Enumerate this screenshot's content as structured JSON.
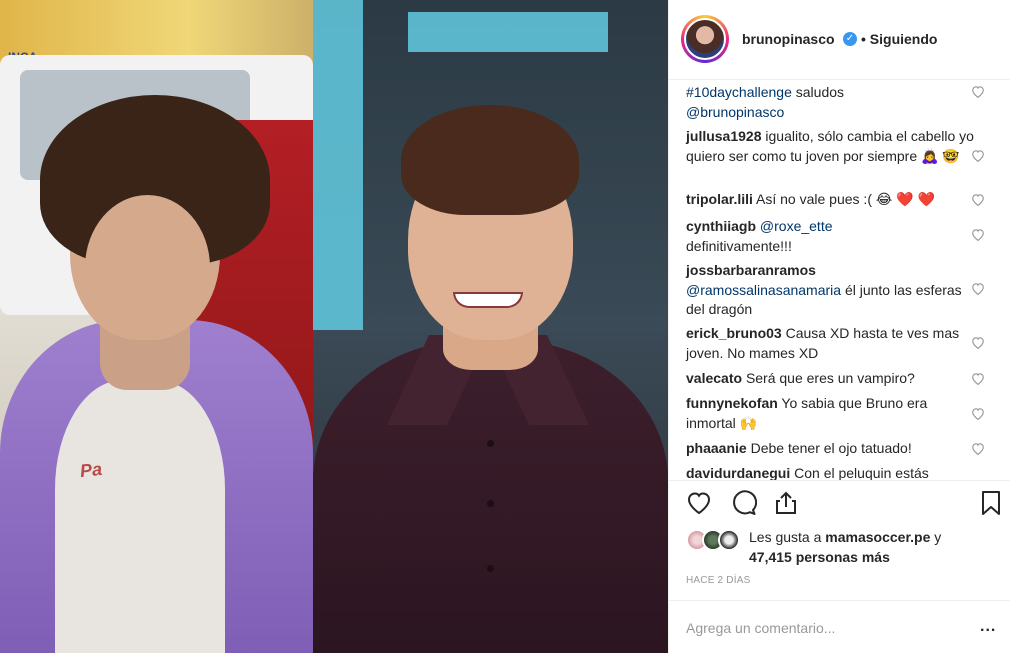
{
  "post": {
    "username": "brunopinasco",
    "verified_mark": "✓",
    "following_label": "• Siguiendo"
  },
  "comments": [
    {
      "user": "",
      "parts": [
        {
          "tag": "#10daychallenge",
          "text": " saludos "
        },
        {
          "tag": "@brunopinasco",
          "text": ""
        }
      ]
    },
    {
      "user": "jullusa1928",
      "text": "igualito, sólo cambia el cabello yo quiero ser como tu joven por siempre 🙇‍♀️ 🤓"
    },
    {
      "user": "tripolar.lili",
      "text": "Así no vale pues :( 😂 ❤️ ❤️"
    },
    {
      "user": "cynthiiagb",
      "tag": "@roxe_ette",
      "text": "definitivamente!!!"
    },
    {
      "user": "jossbarbaranramos",
      "tag": "@ramossalinasanamaria",
      "text": "él junto las esferas del dragón"
    },
    {
      "user": "erick_bruno03",
      "text": "Causa XD hasta te ves mas joven. No mames XD"
    },
    {
      "user": "valecato",
      "text": "Será que eres un vampiro?"
    },
    {
      "user": "funnynekofan",
      "text": "Yo sabia que Bruno era inmortal 🙌"
    },
    {
      "user": "phaaanie",
      "text": "Debe tener el ojo tatuado!"
    },
    {
      "user": "davidurdanegui",
      "text": "Con el peluquin estás"
    }
  ],
  "likes": {
    "prefix": "Les gusta a ",
    "user": "mamasoccer.pe",
    "middle": " y ",
    "count": "47,415 personas más"
  },
  "time_ago": "HACE 2 DÍAS",
  "comment_input": {
    "placeholder": "Agrega un comentario...",
    "more": "..."
  },
  "photo": {
    "left_shirt_text": "Pa"
  },
  "colors": {
    "link": "#003569",
    "verified": "#3897f0",
    "muted": "#999999",
    "border": "#efefef"
  },
  "icons": [
    "heart-icon",
    "comment-icon",
    "share-icon",
    "bookmark-icon",
    "verified-icon",
    "more-options-icon"
  ]
}
